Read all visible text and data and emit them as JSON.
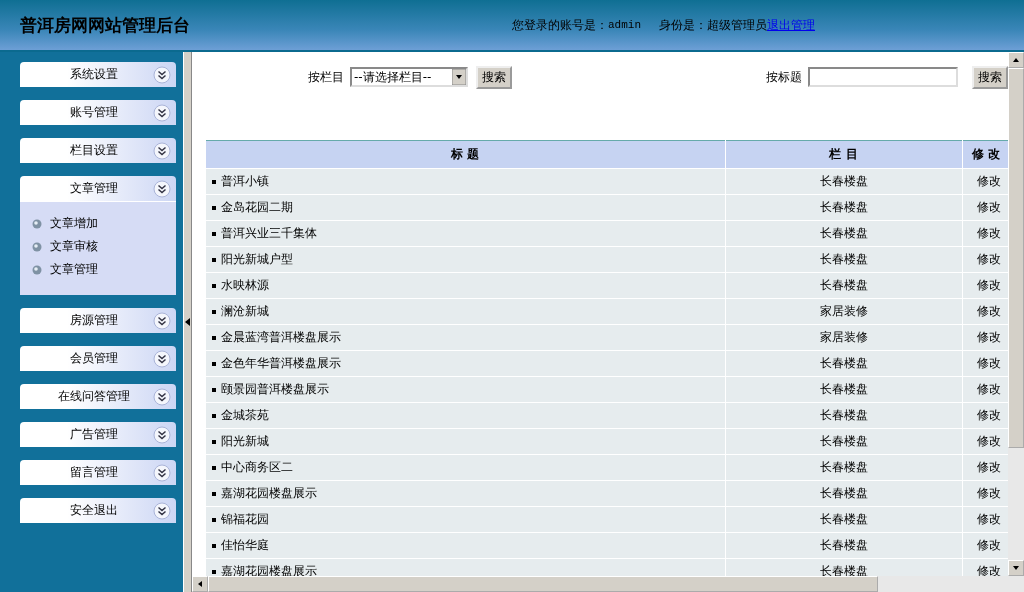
{
  "header": {
    "title": "普洱房网网站管理后台",
    "account_label": "您登录的账号是：",
    "account": "admin",
    "role_label": "身份是：超级管理员",
    "logout_link": " 退出管理"
  },
  "sidebar": {
    "items": [
      {
        "label": "系统设置"
      },
      {
        "label": "账号管理"
      },
      {
        "label": "栏目设置"
      },
      {
        "label": "文章管理",
        "children": [
          {
            "label": "文章增加"
          },
          {
            "label": "文章审核"
          },
          {
            "label": "文章管理"
          }
        ]
      },
      {
        "label": "房源管理"
      },
      {
        "label": "会员管理"
      },
      {
        "label": "在线问答管理"
      },
      {
        "label": "广告管理"
      },
      {
        "label": "留言管理"
      },
      {
        "label": "安全退出"
      }
    ]
  },
  "filters": {
    "category_label": "按栏目",
    "category_select": "--请选择栏目--",
    "category_button": "搜索",
    "title_label": "按标题",
    "title_button": "搜索"
  },
  "table": {
    "columns": [
      "标 题",
      "栏 目",
      "修 改"
    ],
    "rows": [
      {
        "title": "普洱小镇",
        "category": "长春楼盘",
        "action": "修改"
      },
      {
        "title": "金岛花园二期",
        "category": "长春楼盘",
        "action": "修改"
      },
      {
        "title": "普洱兴业三千集体",
        "category": "长春楼盘",
        "action": "修改"
      },
      {
        "title": "阳光新城户型",
        "category": "长春楼盘",
        "action": "修改"
      },
      {
        "title": "水映林源",
        "category": "长春楼盘",
        "action": "修改"
      },
      {
        "title": "澜沧新城",
        "category": "家居装修",
        "action": "修改"
      },
      {
        "title": "金晨蓝湾普洱楼盘展示",
        "category": "家居装修",
        "action": "修改"
      },
      {
        "title": "金色年华普洱楼盘展示",
        "category": "长春楼盘",
        "action": "修改"
      },
      {
        "title": "颐景园普洱楼盘展示",
        "category": "长春楼盘",
        "action": "修改"
      },
      {
        "title": "金城茶苑",
        "category": "长春楼盘",
        "action": "修改"
      },
      {
        "title": "阳光新城",
        "category": "长春楼盘",
        "action": "修改"
      },
      {
        "title": "中心商务区二",
        "category": "长春楼盘",
        "action": "修改"
      },
      {
        "title": "嘉湖花园楼盘展示",
        "category": "长春楼盘",
        "action": "修改"
      },
      {
        "title": "锦福花园",
        "category": "长春楼盘",
        "action": "修改"
      },
      {
        "title": "佳怡华庭",
        "category": "长春楼盘",
        "action": "修改"
      },
      {
        "title": "嘉湖花园楼盘展示",
        "category": "长春楼盘",
        "action": "修改"
      }
    ]
  }
}
